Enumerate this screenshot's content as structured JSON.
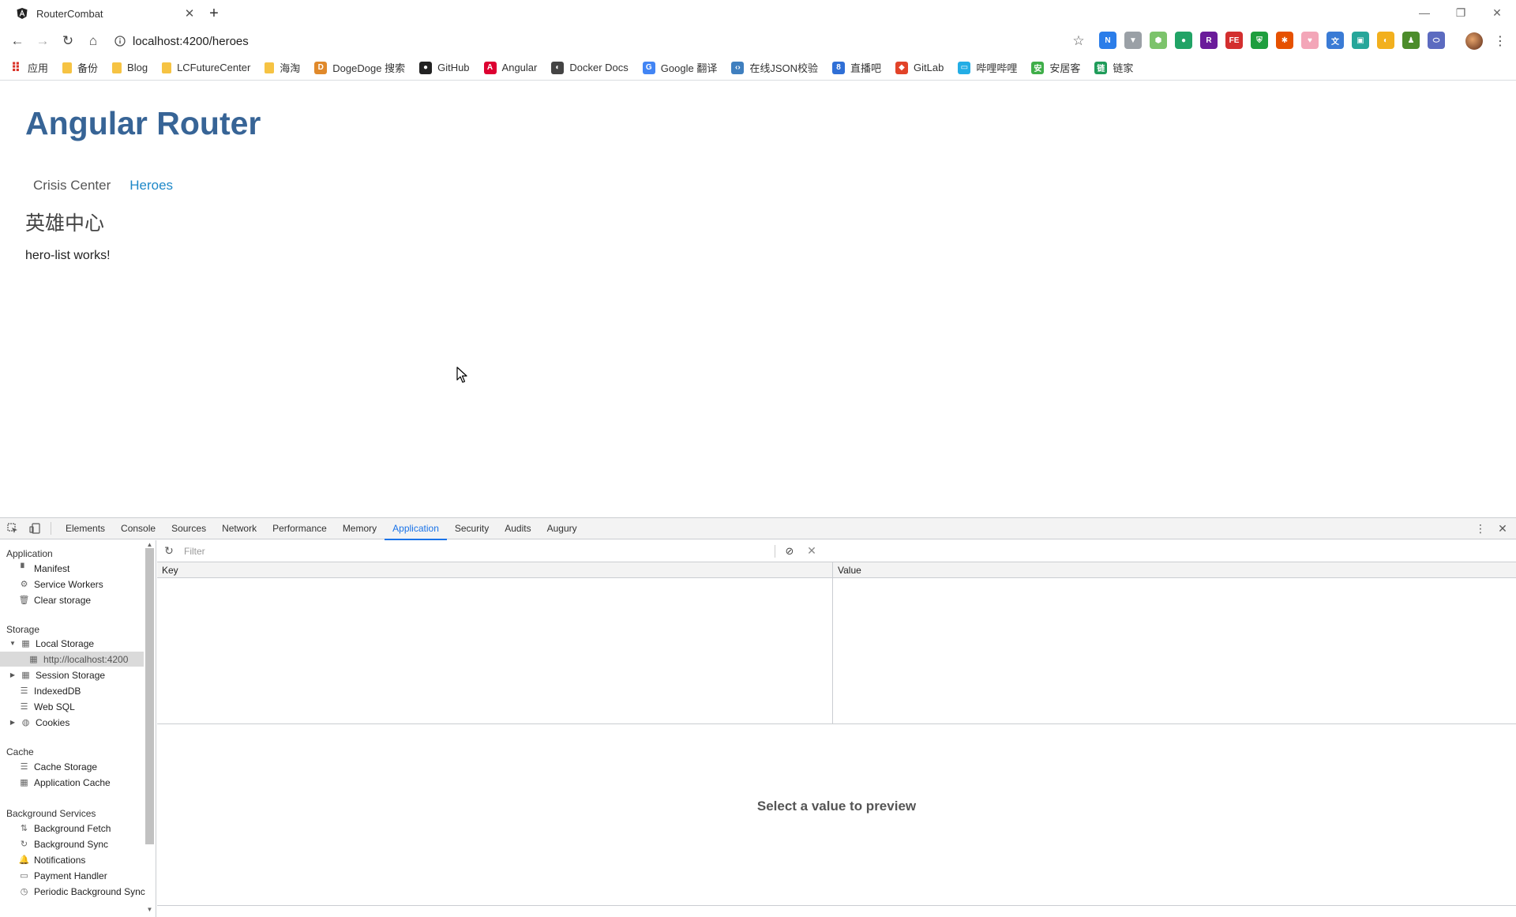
{
  "browser": {
    "tab_title": "RouterCombat",
    "url": "localhost:4200/heroes",
    "bookmarks": [
      {
        "label": "应用",
        "icon": "apps-grid-icon",
        "color": "#d93025"
      },
      {
        "label": "备份",
        "icon": "folder-icon",
        "color": "#f6c343"
      },
      {
        "label": "Blog",
        "icon": "folder-icon",
        "color": "#f6c343"
      },
      {
        "label": "LCFutureCenter",
        "icon": "folder-icon",
        "color": "#f6c343"
      },
      {
        "label": "海淘",
        "icon": "folder-icon",
        "color": "#f6c343"
      },
      {
        "label": "DogeDoge 搜索",
        "icon": "dogedoge-icon",
        "color": "#e0892b"
      },
      {
        "label": "GitHub",
        "icon": "github-icon",
        "color": "#222222"
      },
      {
        "label": "Angular",
        "icon": "angular-icon",
        "color": "#dd0031"
      },
      {
        "label": "Docker Docs",
        "icon": "docker-icon",
        "color": "#444444"
      },
      {
        "label": "Google 翻译",
        "icon": "google-translate-icon",
        "color": "#4285f4"
      },
      {
        "label": "在线JSON校验",
        "icon": "json-icon",
        "color": "#3f7fbf"
      },
      {
        "label": "直播吧",
        "icon": "zhibo8-icon",
        "color": "#2f6fd6"
      },
      {
        "label": "GitLab",
        "icon": "gitlab-icon",
        "color": "#e24329"
      },
      {
        "label": "哔哩哔哩",
        "icon": "bilibili-icon",
        "color": "#23ade5"
      },
      {
        "label": "安居客",
        "icon": "anjuke-icon",
        "color": "#3fae49"
      },
      {
        "label": "链家",
        "icon": "lianjia-icon",
        "color": "#1f9c5a"
      }
    ],
    "extensions": [
      {
        "name": "new-badge-icon",
        "color": "#2b7de9",
        "glyph": "N"
      },
      {
        "name": "vue-devtools-icon",
        "color": "#9aa0a6",
        "glyph": "▼"
      },
      {
        "name": "node-icon",
        "color": "#7cc36b",
        "glyph": "⬢"
      },
      {
        "name": "green-dot-icon",
        "color": "#21a366",
        "glyph": "●"
      },
      {
        "name": "r-icon",
        "color": "#6a1b9a",
        "glyph": "R"
      },
      {
        "name": "fe-helper-icon",
        "color": "#d32f2f",
        "glyph": "FE"
      },
      {
        "name": "shield-icon",
        "color": "#1e9e3e",
        "glyph": "⛨"
      },
      {
        "name": "puzzle-icon",
        "color": "#e65100",
        "glyph": "✱"
      },
      {
        "name": "cat-icon",
        "color": "#f3a6b8",
        "glyph": "♥"
      },
      {
        "name": "translate-icon",
        "color": "#3a7bd5",
        "glyph": "文"
      },
      {
        "name": "screenshot-icon",
        "color": "#26a69a",
        "glyph": "▣"
      },
      {
        "name": "moon-icon",
        "color": "#f2b01e",
        "glyph": "◐"
      },
      {
        "name": "person-icon",
        "color": "#4c8c2b",
        "glyph": "♟"
      },
      {
        "name": "toggle-icon",
        "color": "#5c6bc0",
        "glyph": "⬭"
      }
    ]
  },
  "page": {
    "app_title": "Angular Router",
    "nav": [
      {
        "label": "Crisis Center",
        "active": false
      },
      {
        "label": "Heroes",
        "active": true
      }
    ],
    "section_title": "英雄中心",
    "works_text": "hero-list works!"
  },
  "devtools": {
    "tabs": [
      "Elements",
      "Console",
      "Sources",
      "Network",
      "Performance",
      "Memory",
      "Application",
      "Security",
      "Audits",
      "Augury"
    ],
    "active_tab": "Application",
    "sidebar": {
      "sections": [
        {
          "title": "Application",
          "items": [
            {
              "label": "Manifest",
              "icon": "document-icon"
            },
            {
              "label": "Service Workers",
              "icon": "gear-icon"
            },
            {
              "label": "Clear storage",
              "icon": "trash-icon"
            }
          ]
        },
        {
          "title": "Storage",
          "items": [
            {
              "label": "Local Storage",
              "icon": "grid-icon",
              "expanded": true
            },
            {
              "label": "http://localhost:4200",
              "icon": "grid-icon",
              "selected": true
            },
            {
              "label": "Session Storage",
              "icon": "grid-icon",
              "expandable": true
            },
            {
              "label": "IndexedDB",
              "icon": "database-icon"
            },
            {
              "label": "Web SQL",
              "icon": "database-icon"
            },
            {
              "label": "Cookies",
              "icon": "cookie-icon",
              "expandable": true
            }
          ]
        },
        {
          "title": "Cache",
          "items": [
            {
              "label": "Cache Storage",
              "icon": "database-icon"
            },
            {
              "label": "Application Cache",
              "icon": "grid-icon"
            }
          ]
        },
        {
          "title": "Background Services",
          "items": [
            {
              "label": "Background Fetch",
              "icon": "arrows-updown-icon"
            },
            {
              "label": "Background Sync",
              "icon": "sync-icon"
            },
            {
              "label": "Notifications",
              "icon": "bell-icon"
            },
            {
              "label": "Payment Handler",
              "icon": "card-icon"
            },
            {
              "label": "Periodic Background Sync",
              "icon": "clock-icon"
            }
          ]
        }
      ]
    },
    "filter_placeholder": "Filter",
    "grid": {
      "key_header": "Key",
      "value_header": "Value"
    },
    "preview_text": "Select a value to preview"
  }
}
